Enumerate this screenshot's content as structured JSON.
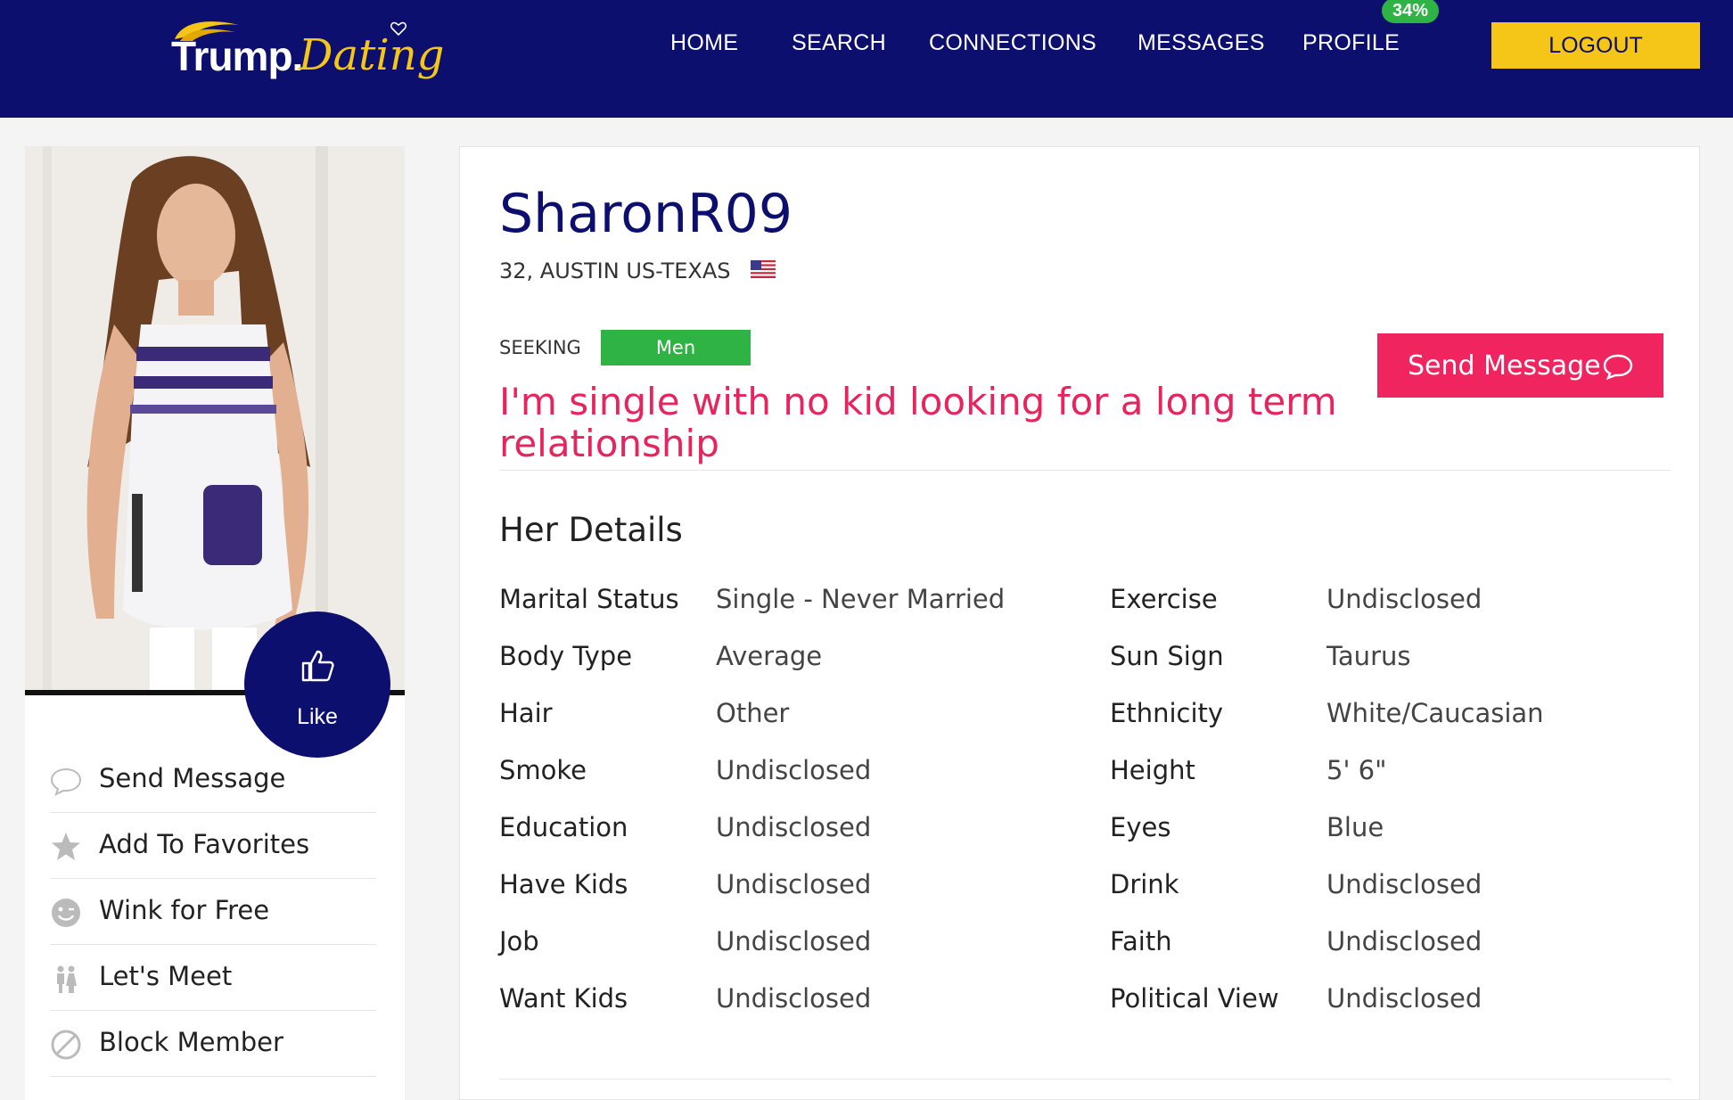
{
  "brand": {
    "logo_main": "Trump.",
    "logo_script": "Dating"
  },
  "nav": {
    "items": [
      "HOME",
      "SEARCH",
      "CONNECTIONS",
      "MESSAGES",
      "PROFILE"
    ],
    "profile_badge": "34%",
    "logout_label": "LOGOUT"
  },
  "sidebar": {
    "like_label": "Like",
    "actions": [
      {
        "label": "Send Message",
        "icon": "chat-bubble-icon"
      },
      {
        "label": "Add To Favorites",
        "icon": "star-icon"
      },
      {
        "label": "Wink for Free",
        "icon": "wink-face-icon"
      },
      {
        "label": "Let's Meet",
        "icon": "couple-icon"
      },
      {
        "label": "Block Member",
        "icon": "block-icon"
      }
    ]
  },
  "profile": {
    "username": "SharonR09",
    "location": "32, AUSTIN US-TEXAS",
    "seeking_label": "SEEKING",
    "seeking_value": "Men",
    "tagline": "I'm single with no kid looking for a long term relationship",
    "send_message_label": "Send Message"
  },
  "details": {
    "title": "Her Details",
    "left": [
      {
        "label": "Marital Status",
        "value": "Single - Never Married"
      },
      {
        "label": "Body Type",
        "value": "Average"
      },
      {
        "label": "Hair",
        "value": "Other"
      },
      {
        "label": "Smoke",
        "value": "Undisclosed"
      },
      {
        "label": "Education",
        "value": "Undisclosed"
      },
      {
        "label": "Have Kids",
        "value": "Undisclosed"
      },
      {
        "label": "Job",
        "value": "Undisclosed"
      },
      {
        "label": "Want Kids",
        "value": "Undisclosed"
      }
    ],
    "right": [
      {
        "label": "Exercise",
        "value": "Undisclosed"
      },
      {
        "label": "Sun Sign",
        "value": "Taurus"
      },
      {
        "label": "Ethnicity",
        "value": "White/Caucasian"
      },
      {
        "label": "Height",
        "value": "5' 6\""
      },
      {
        "label": "Eyes",
        "value": "Blue"
      },
      {
        "label": "Drink",
        "value": "Undisclosed"
      },
      {
        "label": "Faith",
        "value": "Undisclosed"
      },
      {
        "label": "Political View",
        "value": "Undisclosed"
      }
    ]
  },
  "colors": {
    "navy": "#0d0f6e",
    "gold": "#f5c518",
    "green": "#2fb344",
    "pink": "#f0245e"
  }
}
